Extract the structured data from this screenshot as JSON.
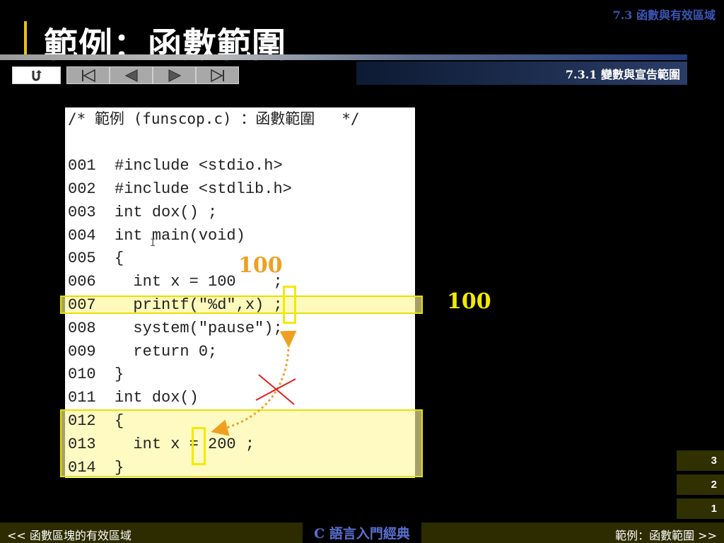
{
  "header": {
    "section": "7.3 函數與有效區域",
    "title": "範例：函數範圍",
    "subsection": "7.3.1 變數與宣告範圍"
  },
  "nav": {
    "home_icon": "return-icon",
    "first_icon": "skip-first-icon",
    "prev_icon": "previous-icon",
    "next_icon": "next-icon",
    "last_icon": "skip-last-icon"
  },
  "code": {
    "comment": "/* 範例 (funscop.c) ：函數範圍   */",
    "lines": [
      "001  #include <stdio.h>",
      "002  #include <stdlib.h>",
      "003  int dox() ;",
      "004  int main(void)",
      "005  {",
      "006    int x = 100    ;",
      "007    printf(\"%d\",x) ;",
      "008    system(\"pause\");",
      "009    return 0;",
      "010  }",
      "011  int dox()",
      "012  {",
      "013    int x = 200 ;",
      "014  }"
    ]
  },
  "annotations": {
    "value_in_main": "100",
    "printed_output": "100",
    "cursor": "I"
  },
  "steps": [
    "3",
    "2",
    "1"
  ],
  "footer": {
    "prev_link": "<< 函數區塊的有效區域",
    "book_title": "C 語言入門經典",
    "next_link": "範例：函數範圍 >>"
  },
  "colors": {
    "accent_yellow": "#f2ea00",
    "accent_orange": "#f0a020",
    "cross_red": "#e02020",
    "brand_blue": "#3a56b8"
  }
}
